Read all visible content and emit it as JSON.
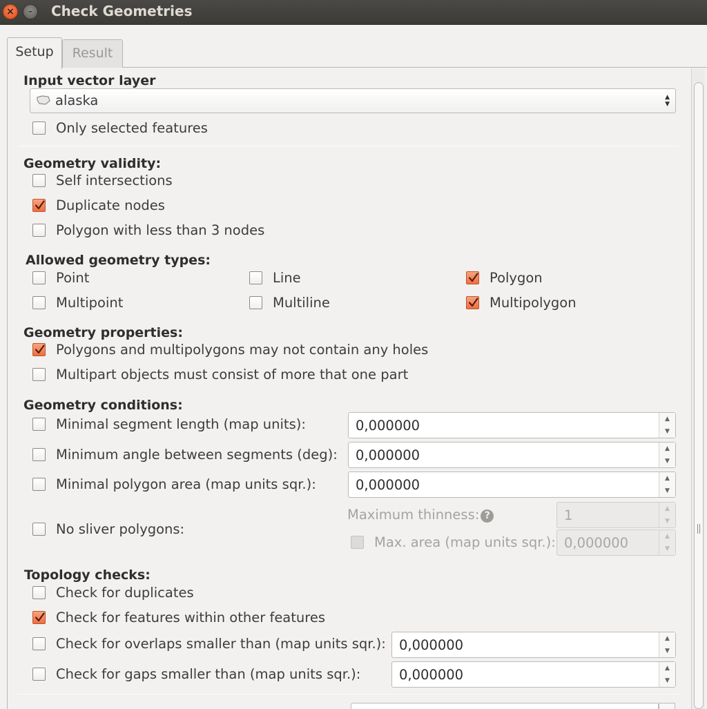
{
  "window": {
    "title": "Check Geometries"
  },
  "tabs": [
    {
      "label": "Setup"
    },
    {
      "label": "Result"
    }
  ],
  "input": {
    "heading": "Input vector layer",
    "layer": "alaska",
    "only_selected": {
      "label": "Only selected features",
      "checked": false
    }
  },
  "validity": {
    "heading": "Geometry validity:",
    "items": [
      {
        "label": "Self intersections",
        "checked": false
      },
      {
        "label": "Duplicate nodes",
        "checked": true
      },
      {
        "label": "Polygon with less than 3 nodes",
        "checked": false
      }
    ]
  },
  "types": {
    "heading": "Allowed geometry types:",
    "items": [
      {
        "label": "Point",
        "checked": false
      },
      {
        "label": "Line",
        "checked": false
      },
      {
        "label": "Polygon",
        "checked": true
      },
      {
        "label": "Multipoint",
        "checked": false
      },
      {
        "label": "Multiline",
        "checked": false
      },
      {
        "label": "Multipolygon",
        "checked": true
      }
    ]
  },
  "properties": {
    "heading": "Geometry properties:",
    "items": [
      {
        "label": "Polygons and multipolygons may not contain any holes",
        "checked": true
      },
      {
        "label": "Multipart objects must consist of more that one part",
        "checked": false
      }
    ]
  },
  "conditions": {
    "heading": "Geometry conditions:",
    "min_segment": {
      "label": "Minimal segment length (map units):",
      "checked": false,
      "value": "0,000000"
    },
    "min_angle": {
      "label": "Minimum angle between segments (deg):",
      "checked": false,
      "value": "0,000000"
    },
    "min_area": {
      "label": "Minimal polygon area (map units sqr.):",
      "checked": false,
      "value": "0,000000"
    },
    "sliver": {
      "label": "No sliver polygons:",
      "checked": false
    },
    "max_thinness": {
      "label": "Maximum thinness:",
      "value": "1"
    },
    "max_area": {
      "label": "Max. area (map units sqr.):",
      "checked": false,
      "value": "0,000000"
    }
  },
  "topology": {
    "heading": "Topology checks:",
    "duplicates": {
      "label": "Check for duplicates",
      "checked": false
    },
    "within": {
      "label": "Check for features within other features",
      "checked": true
    },
    "overlaps": {
      "label": "Check for overlaps smaller than (map units sqr.):",
      "checked": false,
      "value": "0,000000"
    },
    "gaps": {
      "label": "Check for gaps smaller than (map units sqr.):",
      "checked": false,
      "value": "0,000000"
    }
  },
  "colors": {
    "accent": "#ec6f43",
    "titlebar": "#3c3b37",
    "background": "#f2f1f0"
  }
}
